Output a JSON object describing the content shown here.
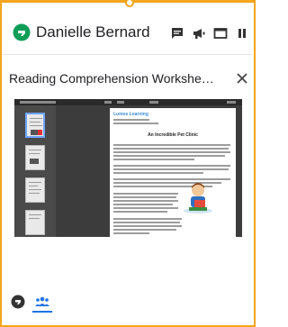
{
  "session": {
    "user_name": "Danielle Bernard",
    "logo_icon": "hangouts-logo-icon",
    "header_icons": [
      "chat-icon",
      "megaphone-icon",
      "window-icon",
      "pause-icon"
    ]
  },
  "shared_tab": {
    "title": "Reading Comprehension Worksheet and ...",
    "close_label": "×"
  },
  "shared_document": {
    "brand": "Lumos Learning",
    "heading": "An Incredible Pet Clinic"
  },
  "footer": {
    "icons": [
      "hangouts-logo-icon",
      "people-icon"
    ]
  },
  "colors": {
    "accent_border": "#f4a51c",
    "logo_green": "#0f9d58",
    "active_tab_blue": "#1a73e8"
  }
}
